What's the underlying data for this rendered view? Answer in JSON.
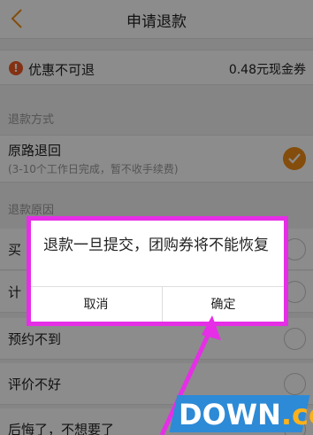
{
  "header": {
    "title": "申请退款"
  },
  "coupon": {
    "label": "优惠不可退",
    "value": "0.48元现金券"
  },
  "refund_method": {
    "section_title": "退款方式",
    "option": {
      "label": "原路退回",
      "sub": "(3-10个工作日完成，暂不收手续费)",
      "checked": true
    }
  },
  "refund_reason": {
    "section_title": "退款原因",
    "items": [
      {
        "label": "买"
      },
      {
        "label": "计"
      },
      {
        "label": "预约不到"
      },
      {
        "label": "评价不好"
      },
      {
        "label": "后悔了，不想要了"
      }
    ]
  },
  "dialog": {
    "message": "退款一旦提交，团购券将不能恢复",
    "cancel_label": "取消",
    "confirm_label": "确定"
  },
  "watermark": {
    "main": "DOWN",
    "suffix": ".cc"
  },
  "colors": {
    "accent": "#f08c17",
    "highlight": "#e62ee6",
    "alert": "#f05a24",
    "watermark": "#2d8ad6"
  }
}
